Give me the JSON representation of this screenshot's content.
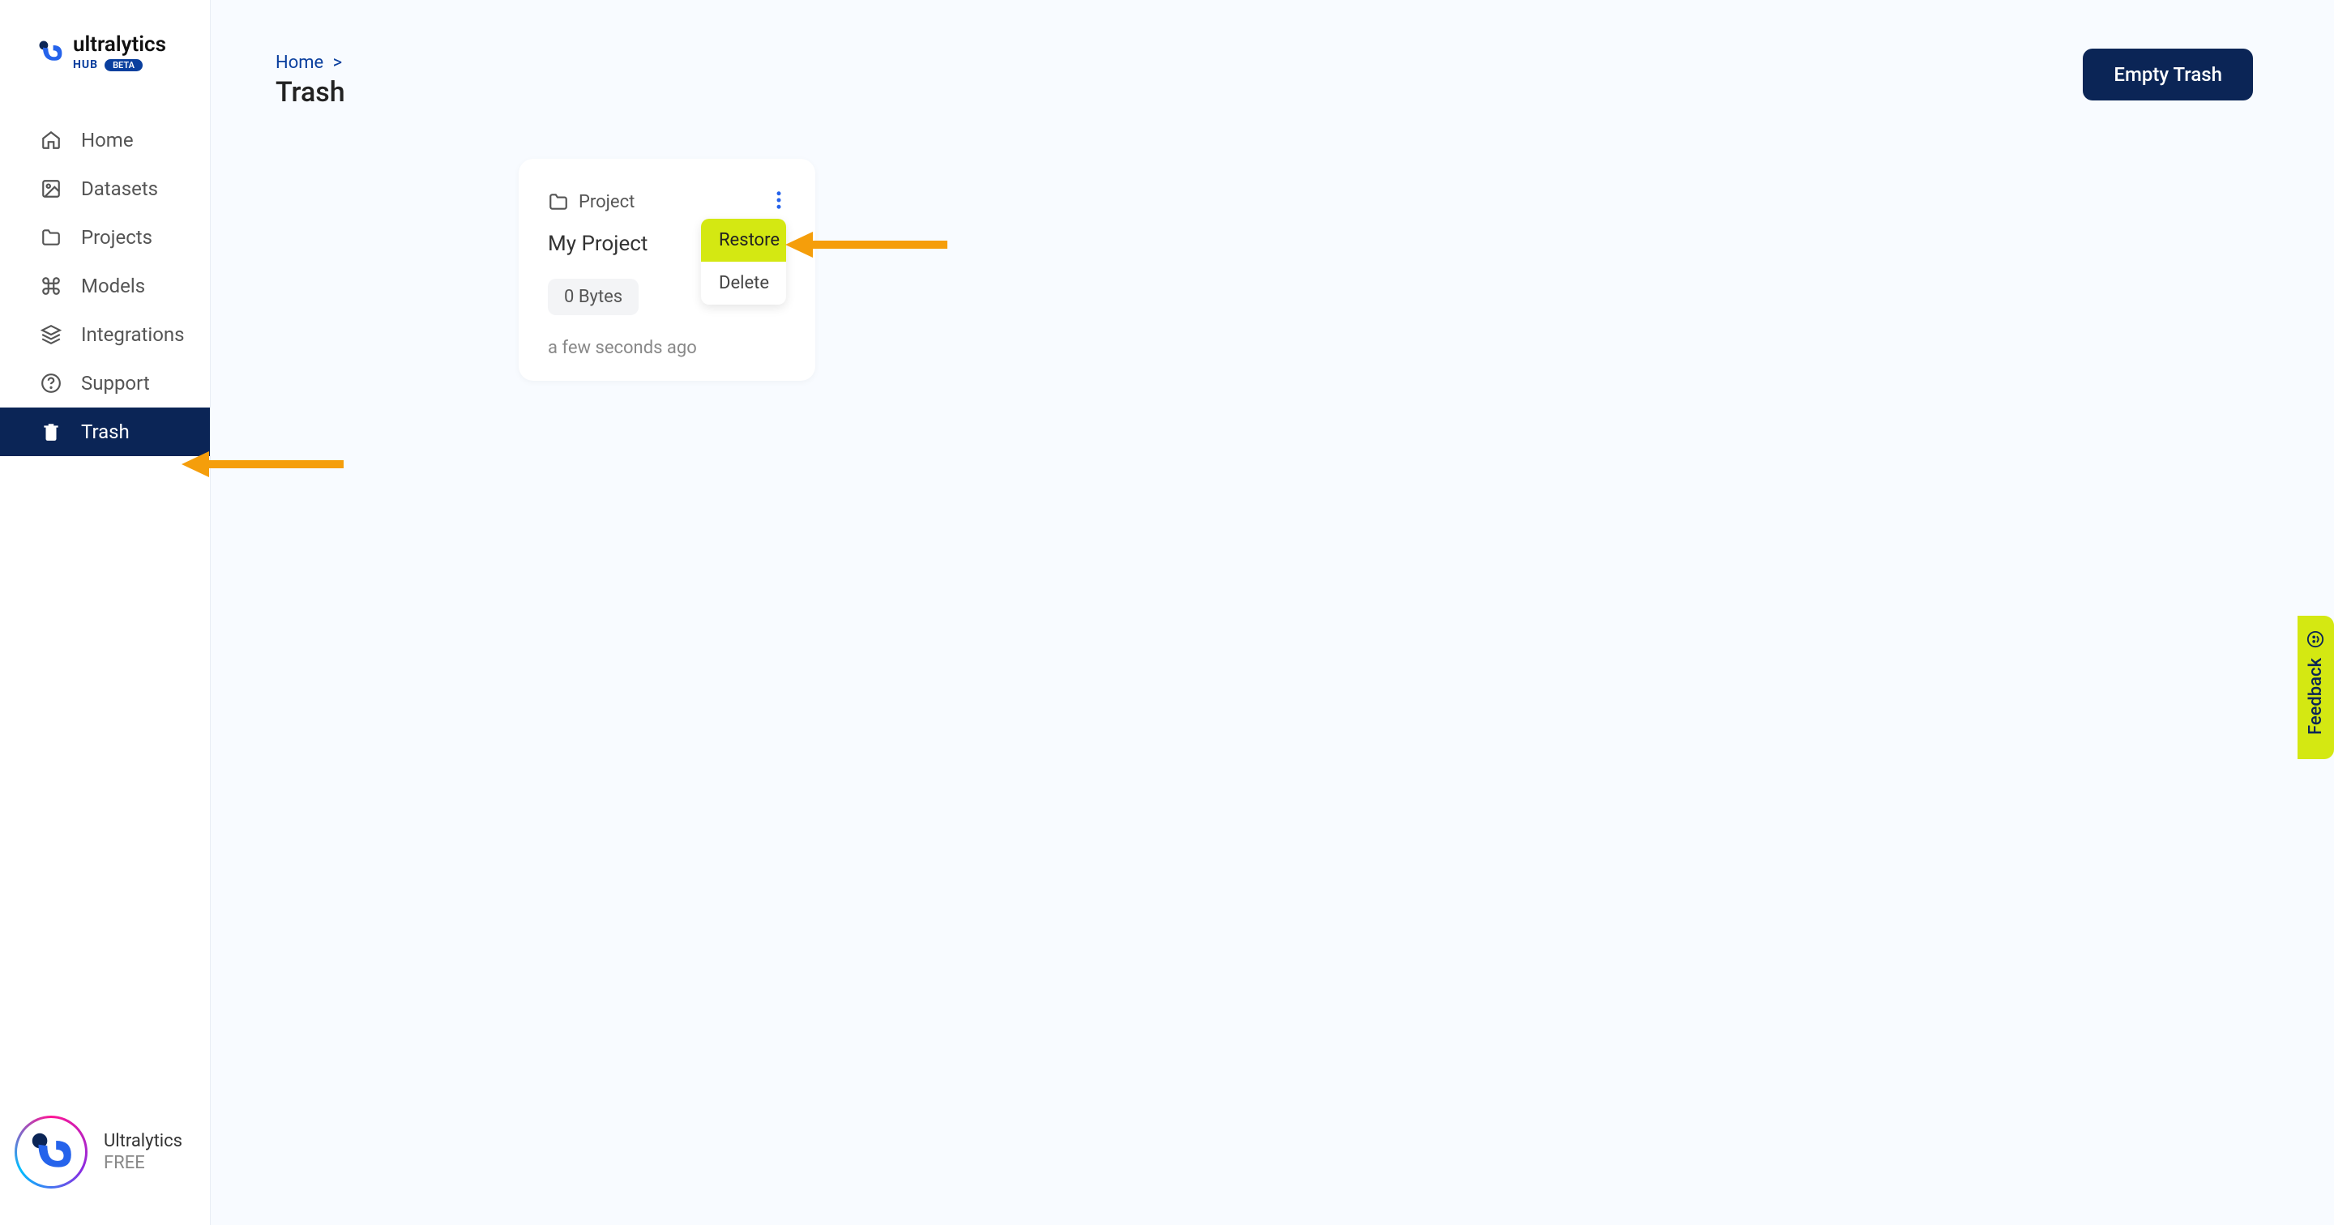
{
  "brand": {
    "name": "ultralytics",
    "sub": "HUB",
    "badge": "BETA"
  },
  "sidebar": {
    "items": [
      {
        "label": "Home",
        "icon": "home"
      },
      {
        "label": "Datasets",
        "icon": "image"
      },
      {
        "label": "Projects",
        "icon": "folder"
      },
      {
        "label": "Models",
        "icon": "command"
      },
      {
        "label": "Integrations",
        "icon": "layers"
      },
      {
        "label": "Support",
        "icon": "help"
      },
      {
        "label": "Trash",
        "icon": "trash",
        "active": true
      }
    ],
    "footer": {
      "name": "Ultralytics",
      "plan": "FREE"
    }
  },
  "breadcrumb": {
    "home": "Home",
    "sep": ">"
  },
  "page": {
    "title": "Trash",
    "empty_btn": "Empty Trash"
  },
  "card": {
    "type": "Project",
    "title": "My Project",
    "size": "0 Bytes",
    "time": "a few seconds ago"
  },
  "dropdown": {
    "restore": "Restore",
    "delete": "Delete"
  },
  "feedback": {
    "label": "Feedback"
  },
  "colors": {
    "primary_dark": "#0b2556",
    "accent_yellow": "#d4e812",
    "arrow_orange": "#f59e0b"
  }
}
